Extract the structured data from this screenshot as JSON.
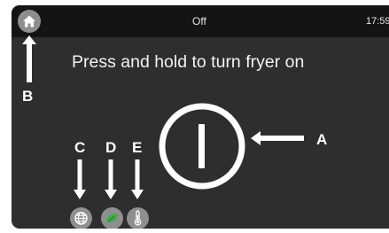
{
  "status_bar": {
    "home_icon": "home-icon",
    "status": "Off",
    "time": "17:59"
  },
  "main": {
    "prompt": "Press and hold to turn fryer on",
    "power_icon": "power-icon"
  },
  "bottom_bar": {
    "buttons": [
      {
        "icon": "globe-icon"
      },
      {
        "icon": "leaf-icon",
        "color": "#3fae49"
      },
      {
        "icon": "thermometer-icon"
      }
    ]
  },
  "callouts": {
    "a": "A",
    "b": "B",
    "c": "C",
    "d": "D",
    "e": "E"
  }
}
